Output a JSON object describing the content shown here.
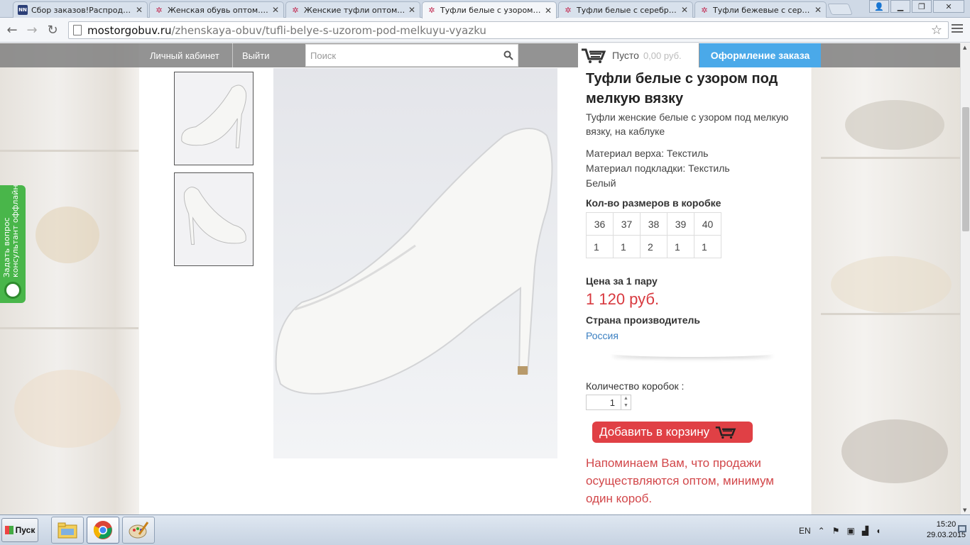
{
  "browser": {
    "tabs": [
      {
        "title": "Сбор заказов!Распродажа",
        "icon": "nn-icon",
        "active": false
      },
      {
        "title": "Женская обувь оптом. Куп",
        "icon": "flower-icon",
        "active": false
      },
      {
        "title": "Женские туфли оптом | Ве",
        "icon": "flower-icon",
        "active": false
      },
      {
        "title": "Туфли белые с узором под",
        "icon": "flower-icon",
        "active": true
      },
      {
        "title": "Туфли белые с серебрист",
        "icon": "flower-icon",
        "active": false
      },
      {
        "title": "Туфли бежевые с серебри",
        "icon": "flower-icon",
        "active": false
      }
    ],
    "url_host": "mostorgobuv.ru",
    "url_path": "/zhenskaya-obuv/tufli-belye-s-uzorom-pod-melkuyu-vyazku"
  },
  "site": {
    "account_link": "Личный кабинет",
    "logout_link": "Выйти",
    "search_placeholder": "Поиск",
    "cart_status": "Пусто",
    "cart_sum": "0,00 руб.",
    "checkout_button": "Оформление заказа",
    "ask_tab_line1": "Задать вопрос",
    "ask_tab_line2": "консультант оффлайн"
  },
  "product": {
    "title": "Туфли белые с узором под мелкую вязку",
    "subtitle": "Туфли женские белые с узором под мелкую вязку, на каблуке",
    "material_top": "Материал верха: Текстиль",
    "material_lining": "Материал подкладки: Текстиль",
    "color": "Белый",
    "sizes_heading": "Кол-во размеров в коробке",
    "sizes": [
      "36",
      "37",
      "38",
      "39",
      "40"
    ],
    "counts": [
      "1",
      "1",
      "2",
      "1",
      "1"
    ],
    "price_heading": "Цена за 1 пару",
    "price": "1 120 руб.",
    "country_heading": "Страна производитель",
    "country": "Россия",
    "qty_label": "Количество коробок :",
    "qty_value": "1",
    "add_to_cart": "Добавить в корзину",
    "notice": "Напоминаем Вам, что продажи осуществляются оптом, минимум один короб."
  },
  "taskbar": {
    "start_label": "Пуск",
    "language": "EN",
    "time": "15:20",
    "date": "29.03.2015"
  },
  "colors": {
    "accent_blue": "#4aa9e9",
    "price_red": "#d8393f",
    "button_red": "#e04045",
    "link_blue": "#3a7fc1",
    "ask_green": "#49b64a"
  }
}
